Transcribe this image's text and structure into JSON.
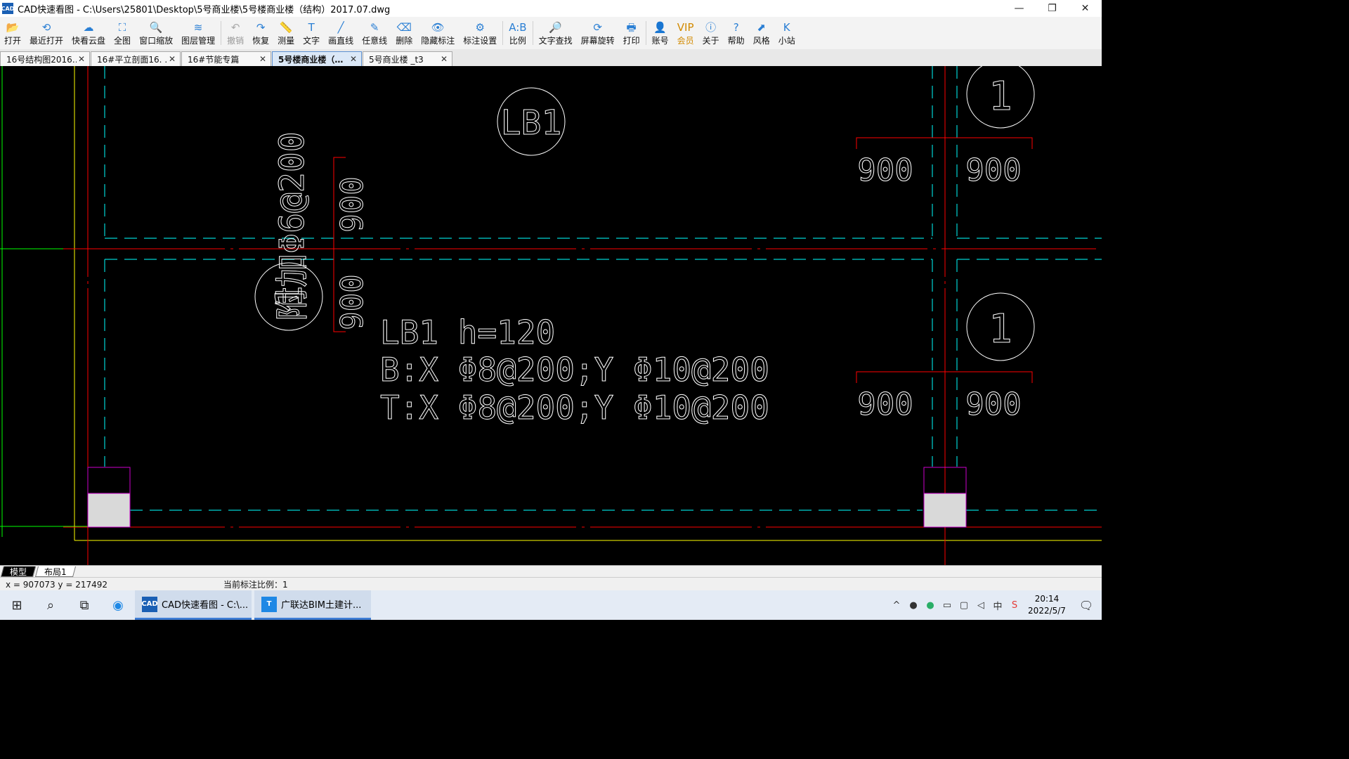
{
  "window": {
    "title": "CAD快速看图 - C:\\Users\\25801\\Desktop\\5号商业楼\\5号楼商业楼（结构）2017.07.dwg",
    "minimize": "—",
    "restore": "❐",
    "close": "✕",
    "app_icon_label": "CAD"
  },
  "toolbar": {
    "items": [
      {
        "label": "打开",
        "icon": "folder-open-icon",
        "glyph": "📂"
      },
      {
        "label": "最近打开",
        "icon": "history-icon",
        "glyph": "⟲"
      },
      {
        "label": "快看云盘",
        "icon": "cloud-icon",
        "glyph": "☁"
      },
      {
        "label": "全图",
        "icon": "fit-all-icon",
        "glyph": "⛶"
      },
      {
        "label": "窗口缩放",
        "icon": "zoom-window-icon",
        "glyph": "🔍"
      },
      {
        "label": "图层管理",
        "icon": "layers-icon",
        "glyph": "≋"
      },
      {
        "label": "撤销",
        "icon": "undo-icon",
        "glyph": "↶",
        "disabled": true
      },
      {
        "label": "恢复",
        "icon": "redo-icon",
        "glyph": "↷"
      },
      {
        "label": "测量",
        "icon": "ruler-icon",
        "glyph": "📏"
      },
      {
        "label": "文字",
        "icon": "text-icon",
        "glyph": "T"
      },
      {
        "label": "画直线",
        "icon": "line-icon",
        "glyph": "╱"
      },
      {
        "label": "任意线",
        "icon": "pen-icon",
        "glyph": "✎"
      },
      {
        "label": "删除",
        "icon": "eraser-icon",
        "glyph": "⌫"
      },
      {
        "label": "隐藏标注",
        "icon": "eye-icon",
        "glyph": "👁"
      },
      {
        "label": "标注设置",
        "icon": "annotation-settings-icon",
        "glyph": "⚙"
      },
      {
        "label": "比例",
        "icon": "scale-icon",
        "glyph": "A:B"
      },
      {
        "label": "文字查找",
        "icon": "text-search-icon",
        "glyph": "🔎"
      },
      {
        "label": "屏幕旋转",
        "icon": "rotate-icon",
        "glyph": "⟳"
      },
      {
        "label": "打印",
        "icon": "printer-icon",
        "glyph": "🖶"
      },
      {
        "label": "账号",
        "icon": "user-icon",
        "glyph": "👤"
      },
      {
        "label": "会员",
        "icon": "vip-icon",
        "glyph": "VIP",
        "vip": true
      },
      {
        "label": "关于",
        "icon": "info-icon",
        "glyph": "ⓘ"
      },
      {
        "label": "帮助",
        "icon": "help-icon",
        "glyph": "?"
      },
      {
        "label": "风格",
        "icon": "style-icon",
        "glyph": "⬈"
      },
      {
        "label": "小站",
        "icon": "site-icon",
        "glyph": "K"
      }
    ]
  },
  "tabs": [
    {
      "label": "16号结构图2016…",
      "active": false
    },
    {
      "label": "16#平立剖面16. …",
      "active": false
    },
    {
      "label": "16#节能专篇",
      "active": false
    },
    {
      "label": "5号楼商业楼（…",
      "active": true
    },
    {
      "label": "5号商业楼 _t3",
      "active": false
    }
  ],
  "tab_close": "✕",
  "drawing": {
    "label_lb1": "LB1",
    "slab_note_1": "LB1 h=120",
    "slab_note_2": "B:X Φ8@200;Y Φ10@200",
    "slab_note_3": "T:X Φ8@200;Y Φ10@200",
    "rebar_note": "附加Φ6@200",
    "dim_900": "900",
    "section_1": "1",
    "colors": {
      "grid": "#ff0000",
      "beam": "#00d4d4",
      "text": "#ffffff",
      "column": "#cc00cc",
      "axis": "#00ff00",
      "border": "#ffff00",
      "fill": "#d9d9d9"
    }
  },
  "layout_tabs": [
    {
      "label": "模型",
      "active": true
    },
    {
      "label": "布局1",
      "active": false
    }
  ],
  "status": {
    "coords": "x = 907073  y = 217492",
    "scale": "当前标注比例：1"
  },
  "taskbar": {
    "apps": [
      {
        "label": "CAD快速看图 - C:\\...",
        "icon": "cad-app-icon",
        "color": "#1a5fb4",
        "glyph": "CAD"
      },
      {
        "label": "广联达BIM土建计...",
        "icon": "glodon-app-icon",
        "color": "#1e88e5",
        "glyph": "T"
      }
    ],
    "time": "20:14",
    "date": "2022/5/7"
  }
}
